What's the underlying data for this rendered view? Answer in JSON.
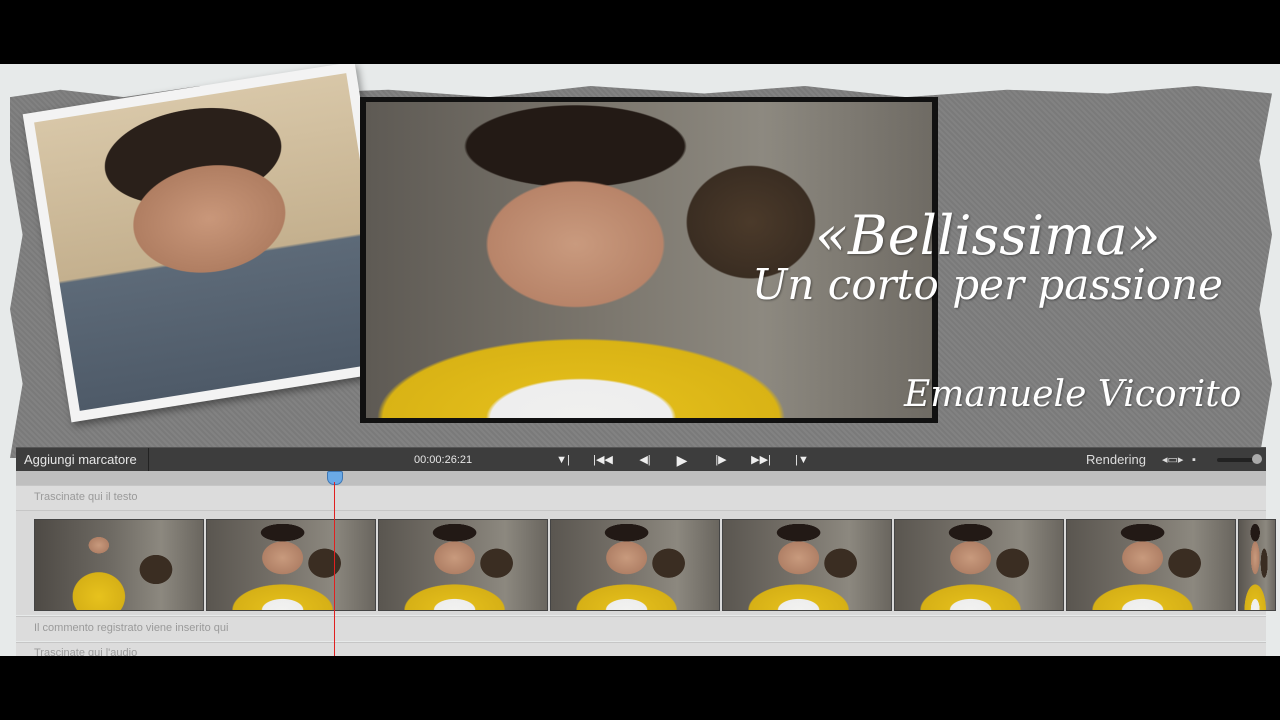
{
  "poster": {
    "title": "«Bellissima»",
    "subtitle": "Un corto per passione",
    "author": "Emanuele Vicorito"
  },
  "toolbar": {
    "add_marker_label": "Aggiungi marcatore",
    "timecode": "00:00:26:21",
    "rendering_label": "Rendering",
    "transport_icons": [
      "mark-in-icon",
      "go-to-start-icon",
      "step-back-icon",
      "play-icon",
      "step-forward-icon",
      "go-to-end-icon",
      "mark-out-icon"
    ]
  },
  "tracks": {
    "text_track_placeholder": "Trascinate qui il testo",
    "comment_track_placeholder": "Il commento registrato viene inserito qui",
    "audio_track_placeholder": "Trascinate qui l'audio"
  }
}
